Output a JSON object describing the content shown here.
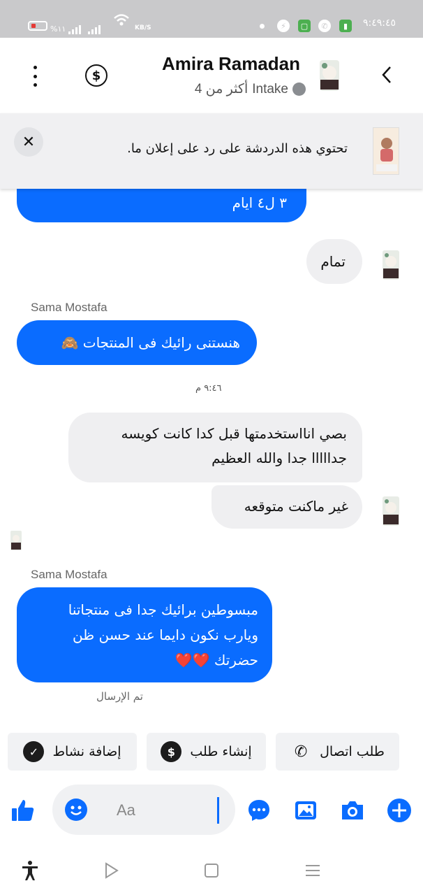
{
  "status_bar": {
    "battery_pct": "%١١",
    "network_speed": "KB/S",
    "time": "٩:٤٩:٤٥"
  },
  "header": {
    "title": "Amira Ramadan",
    "subtitle_label": "Intake",
    "subtitle_more": "أكثر من 4",
    "icons": [
      "kebab-menu-icon",
      "dollar-icon",
      "back-chevron-icon"
    ]
  },
  "banner": {
    "text": "تحتوي هذه الدردشة على رد على إعلان ما.",
    "close_glyph": "✕"
  },
  "messages": [
    {
      "side": "out",
      "text": "٣ ل٤ ايام"
    },
    {
      "side": "in",
      "text": "تمام"
    },
    {
      "sender": "Sama Mostafa",
      "side": "out",
      "text": "هنستنى رائيك فى المنتجات 🙈"
    },
    {
      "timestamp": "٩:٤٦ م"
    },
    {
      "side": "in",
      "lines": [
        "بصي انااستخدمتها قبل كدا كانت كويسه",
        "جدااااا جدا والله العظيم"
      ]
    },
    {
      "side": "in",
      "text": "غير ماكنت متوقعه"
    },
    {
      "sender": "Sama Mostafa",
      "side": "out",
      "lines": [
        "مبسوطين برائيك جدا فى منتجاتنا",
        "ويارب نكون دايما عند حسن ظن",
        "حضرتك ❤️❤️"
      ]
    }
  ],
  "sent_status": "تم الإرسال",
  "quick_actions": [
    {
      "label": "إضافة نشاط",
      "icon": "check-circle-icon",
      "glyph": "✓"
    },
    {
      "label": "إنشاء طلب",
      "icon": "dollar-circle-icon",
      "glyph": "$"
    },
    {
      "label": "طلب اتصال",
      "icon": "phone-add-icon",
      "glyph": "✆"
    }
  ],
  "composer": {
    "placeholder": "Aa",
    "icons": [
      "thumbs-up-icon",
      "emoji-icon",
      "chat-icon",
      "gallery-icon",
      "camera-icon",
      "plus-icon"
    ]
  },
  "colors": {
    "accent": "#0a6cff",
    "bubble_gray": "#efeff1",
    "statusbar": "#c9c9cb"
  }
}
